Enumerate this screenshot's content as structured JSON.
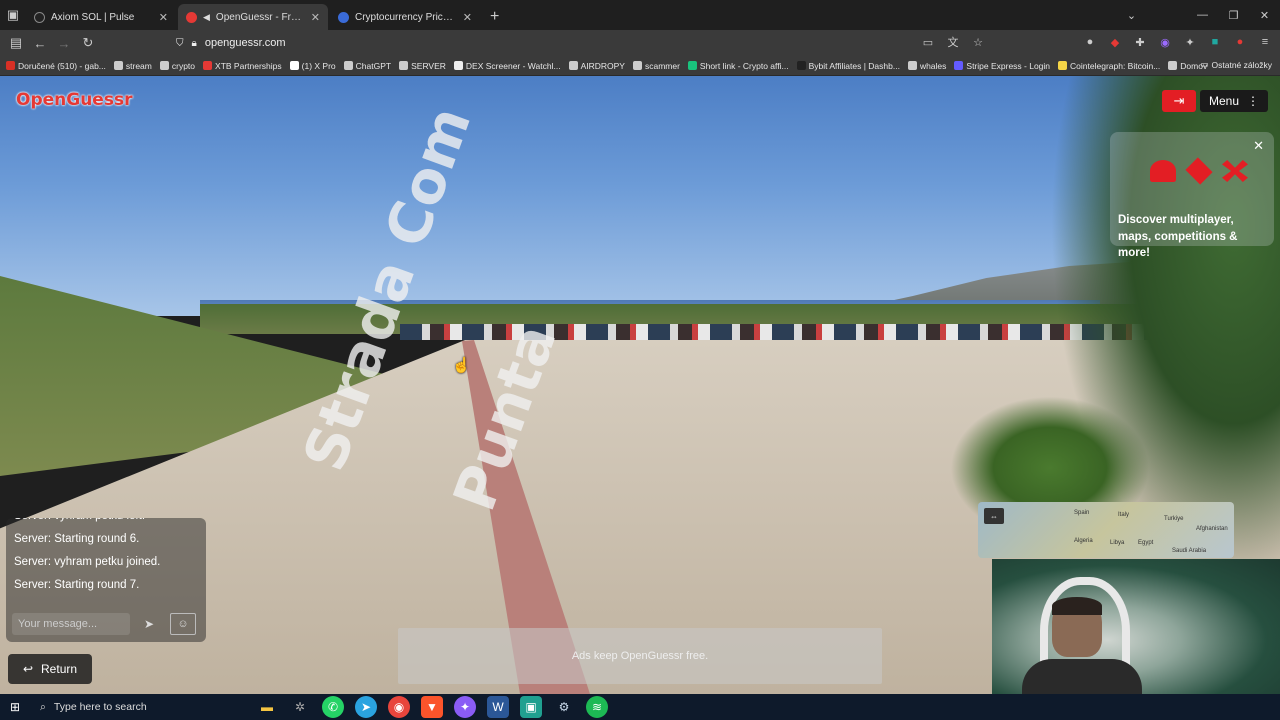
{
  "browser": {
    "tabs": [
      {
        "title": "Axiom SOL | Pulse",
        "favicon_color": "#222222"
      },
      {
        "title": "OpenGuessr - Free GeoGuessr",
        "favicon_color": "#e53935",
        "active": true
      },
      {
        "title": "Cryptocurrency Prices, Charts A",
        "favicon_color": "#3a6bd8"
      }
    ],
    "url": "openguessr.com",
    "bookmarks": [
      {
        "label": "Doručené (510) - gab...",
        "color": "#d93025"
      },
      {
        "label": "stream",
        "color": "#cccccc"
      },
      {
        "label": "crypto",
        "color": "#cccccc"
      },
      {
        "label": "XTB Partnerships",
        "color": "#e53935"
      },
      {
        "label": "(1) X Pro",
        "color": "#ffffff"
      },
      {
        "label": "ChatGPT",
        "color": "#cccccc"
      },
      {
        "label": "SERVER",
        "color": "#cccccc"
      },
      {
        "label": "DEX Screener - Watchl...",
        "color": "#eeeeee"
      },
      {
        "label": "AIRDROPY",
        "color": "#cccccc"
      },
      {
        "label": "scammer",
        "color": "#cccccc"
      },
      {
        "label": "Short link - Crypto affi...",
        "color": "#19c37d"
      },
      {
        "label": "Bybit Affiliates | Dashb...",
        "color": "#222222"
      },
      {
        "label": "whales",
        "color": "#cccccc"
      },
      {
        "label": "Stripe Express - Login",
        "color": "#635bff"
      },
      {
        "label": "Cointelegraph: Bitcoin...",
        "color": "#f5d547"
      },
      {
        "label": "Domov",
        "color": "#cccccc"
      }
    ],
    "other_bookmarks": "Ostatné záložky"
  },
  "game": {
    "logo": "OpenGuessr",
    "menu_label": "Menu",
    "promo_text": "Discover multiplayer, maps, competitions & more!",
    "road_text_1": "Strada Com",
    "road_text_2": "Punta",
    "chat": {
      "lines": [
        "Server: vyhram petku left.",
        "Server: Starting round 6.",
        "Server: vyhram petku joined.",
        "Server: Starting round 7."
      ],
      "placeholder": "Your message..."
    },
    "return_label": "Return",
    "ads_text": "Ads keep OpenGuessr free.",
    "map_labels": [
      "Spain",
      "Italy",
      "Turkiye",
      "Algeria",
      "Libya",
      "Egypt",
      "Saudi Arabia",
      "Afghanistan"
    ]
  },
  "taskbar": {
    "search_placeholder": "Type here to search"
  }
}
